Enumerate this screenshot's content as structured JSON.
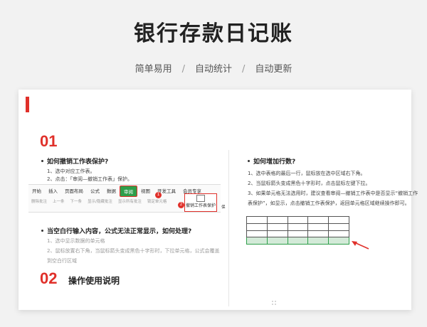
{
  "header": {
    "title": "银行存款日记账",
    "features": [
      "简单易用",
      "自动统计",
      "自动更新"
    ],
    "separator": "/"
  },
  "section1": {
    "number": "01",
    "left": {
      "heading": "如何撤销工作表保护?",
      "steps": [
        "1、选中对应工作表。",
        "2、点击：「审阅—撤销工作表」保护。"
      ],
      "ribbon_tabs": [
        "开始",
        "插入",
        "页面布局",
        "公式",
        "数据",
        "审阅",
        "视图",
        "开发工具",
        "会员专享"
      ],
      "active_tab": "审阅",
      "ribbon_tools": [
        "删除批注",
        "上一条",
        "下一条",
        "显示/隐藏批注",
        "显示所有批注",
        "重置所有批注",
        "锁定单元格"
      ],
      "big_button": "撤销工作表保护",
      "protect_label": "保",
      "badge1": "1",
      "badge2": "2",
      "heading2": "当空白行输入内容，公式无法正常显示，如何处理?",
      "steps2": [
        "1、选中显示数据的单元格",
        "2、鼠标放置右下角，当鼠标箭头变成黑色十字形时，下拉单元格，公式会覆盖",
        "到空白行区域"
      ]
    },
    "right": {
      "heading": "如何增加行数?",
      "steps": [
        "1、选中表格的最后一行，鼠标放在选中区域右下角。",
        "2、当鼠标箭头变成黑色十字形时，点击鼠标左键下拉。",
        "3、如果单元格无法选用时，建议查看审阅—撤销工作表中是否显示“撤销工作",
        "表保护”，如显示，点击撤销工作表保护，返回单元格区域继续操作即可。"
      ]
    }
  },
  "section2": {
    "number": "02",
    "heading": "操作使用说明"
  },
  "colors": {
    "accent": "#e0302a",
    "highlight": "#2e9e4a"
  }
}
